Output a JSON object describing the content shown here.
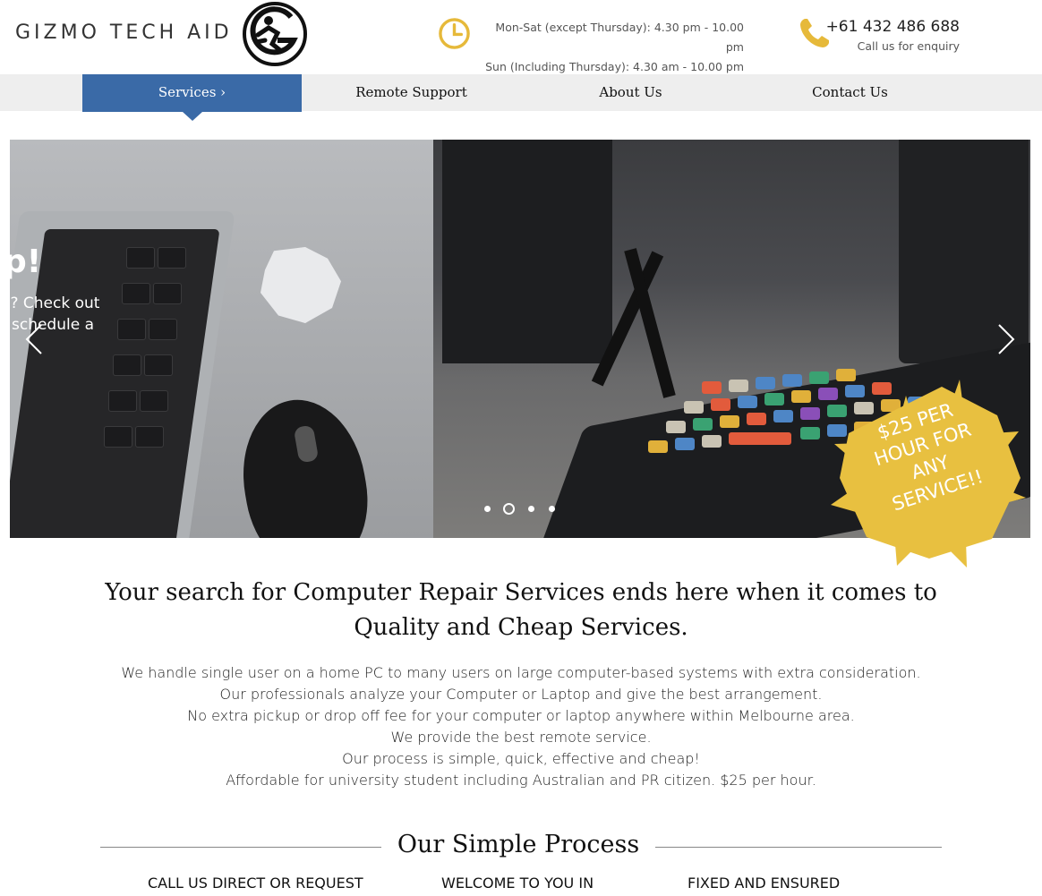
{
  "header": {
    "brand": "GIZMO TECH AID",
    "logo_icon": "gizmo-g-logo",
    "clock_icon": "clock-icon",
    "hours_line1": "Mon-Sat (except Thursday): 4.30 pm - 10.00 pm",
    "hours_line2": "Sun (Including Thursday): 4.30 am - 10.00 pm",
    "phone_icon": "phone-icon",
    "phone_number": "+61 432 486 688",
    "phone_caption": "Call us for enquiry",
    "accent_color": "#e6b93a"
  },
  "nav": {
    "items": [
      {
        "label": "Services ›",
        "active": true
      },
      {
        "label": "Remote Support",
        "active": false
      },
      {
        "label": "About Us",
        "active": false
      },
      {
        "label": "Contact Us",
        "active": false
      }
    ],
    "active_color": "#3a6aa7"
  },
  "slider": {
    "heading_fragment": "p!",
    "line1_fragment": "e? Check out",
    "line2_fragment": "schedule a",
    "prev_icon": "chevron-left-icon",
    "next_icon": "chevron-right-icon",
    "slide_count": 4,
    "active_slide": 2,
    "promo_badge": {
      "lines": [
        "$25 PER",
        "HOUR FOR",
        "ANY",
        "SERVICE!!"
      ],
      "color": "#e8c040"
    }
  },
  "main": {
    "headline_line1": "Your search for Computer Repair Services ends here when it comes to",
    "headline_line2": "Quality and Cheap Services.",
    "paragraph": [
      "We handle single user on a home PC to many users on large computer-based systems with extra consideration.",
      "Our professionals analyze your Computer or Laptop and give the best arrangement.",
      "No extra pickup or drop off fee for your computer or laptop anywhere within Melbourne area.",
      "We provide the best remote service.",
      "Our process is simple, quick, effective and cheap!",
      "Affordable for university student including Australian and PR citizen. $25 per hour."
    ],
    "process_title": "Our Simple Process",
    "steps": [
      "CALL US DIRECT OR REQUEST",
      "WELCOME TO YOU IN",
      "FIXED AND ENSURED"
    ]
  }
}
